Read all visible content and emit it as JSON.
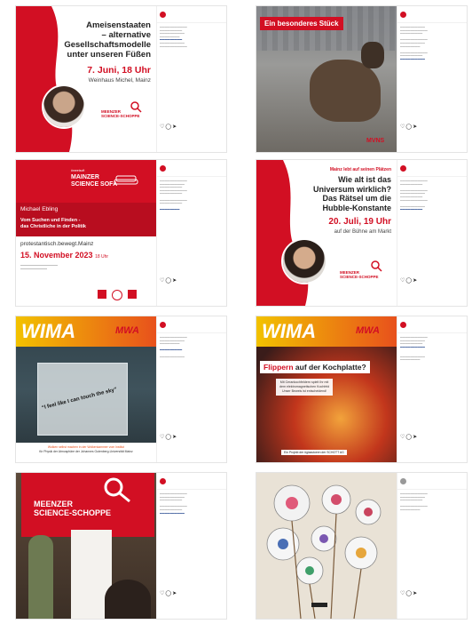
{
  "colors": {
    "accent": "#d20f23",
    "wima_yellow": "#f2c200",
    "wima_orange": "#e8511c",
    "text_dark": "#1b1b1b"
  },
  "icons": {
    "like": "heart-icon",
    "comment": "comment-icon",
    "share": "paper-plane-icon",
    "save": "bookmark-icon"
  },
  "posts": [
    {
      "title_lines": [
        "Ameisenstaaten",
        "– alternative",
        "Gesellschaftsmodelle",
        "unter unseren Füßen"
      ],
      "date": "7. Juni, 18 Uhr",
      "venue": "Weinhaus Michel, Mainz",
      "logo": [
        "MEENZER",
        "SCIENCE-SCHOPPE"
      ]
    },
    {
      "title": "Ein besonderes Stück",
      "logo": "MVNS"
    },
    {
      "kicker": "#meetsoft",
      "series": [
        "MAINZER",
        "SCIENCE SOFA"
      ],
      "speaker": "Michael Ebling",
      "talk_lines": [
        "Vom Suchen und Finden -",
        "das Christliche in der Politik"
      ],
      "hashtag": "protestantisch.bewegt.Mainz",
      "date": "15. November 2023",
      "time": "18 Uhr"
    },
    {
      "kicker": "Mainz lebt auf seinen Plätzen",
      "title_lines": [
        "Wie alt ist das",
        "Universum wirklich?",
        "Das Rätsel um die",
        "Hubble-Konstante"
      ],
      "date": "20. Juli, 19 Uhr",
      "venue": "auf der Bühne am Markt",
      "logo": [
        "MEENZER",
        "SCIENCE-SCHOPPE"
      ]
    },
    {
      "brand": "WIMA",
      "brand2": "MWA",
      "quote": "“I feel like I can touch the sky”",
      "bottom_lines": [
        "Wolken selbst machen in der Wolkenkammer vom Institut",
        "für Physik der Atmosphäre der Johannes Gutenberg-Universität Mainz"
      ]
    },
    {
      "brand": "WIMA",
      "brand2": "MWA",
      "headline_a": "Flippern",
      "headline_b": "auf der Kochplatte?",
      "sub_lines": [
        "Mit Cerankochfeldern spielt Ihr mit",
        "dem elektromagnetischen Kochfeld",
        "Unser Beweis ist entscheidend!"
      ],
      "footer": "Ein Projekt der #glasstoeen der SCHOTT AG"
    },
    {
      "logo": [
        "MEENZER",
        "SCIENCE-SCHOPPE"
      ]
    },
    {}
  ]
}
